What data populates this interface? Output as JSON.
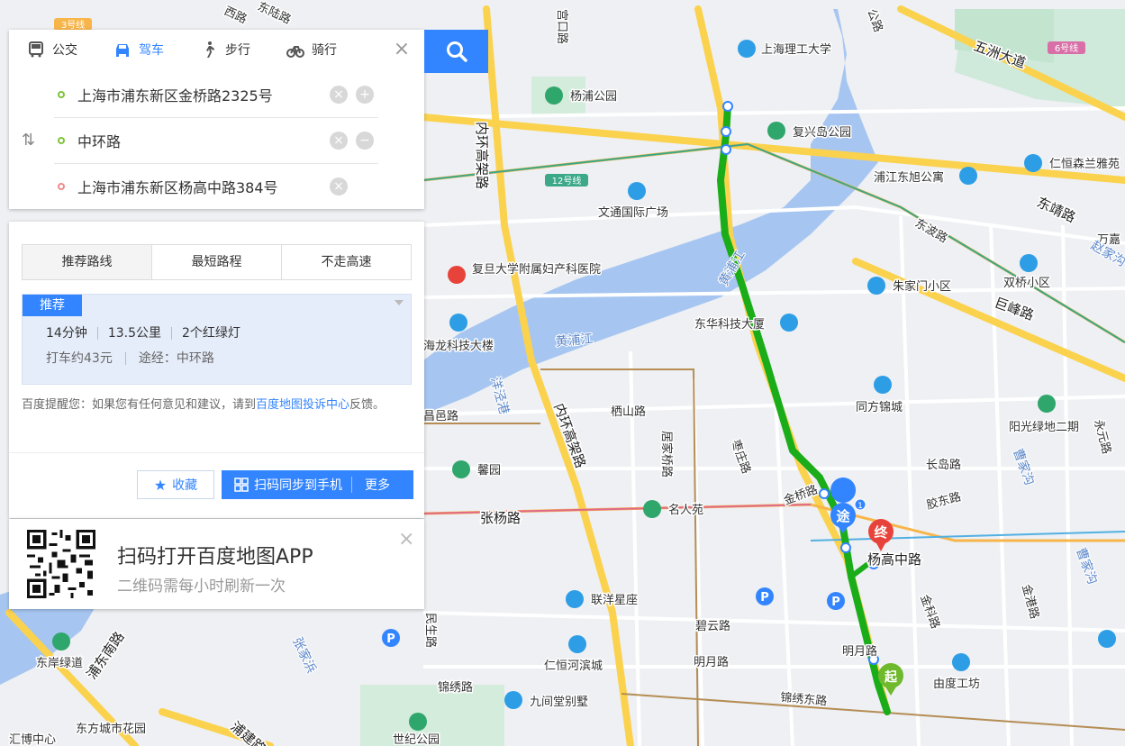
{
  "modes": [
    {
      "label": "公交",
      "icon": "bus-icon"
    },
    {
      "label": "驾车",
      "icon": "car-icon"
    },
    {
      "label": "步行",
      "icon": "walk-icon"
    },
    {
      "label": "骑行",
      "icon": "bike-icon"
    }
  ],
  "active_mode": "驾车",
  "route": {
    "start": "上海市浦东新区金桥路2325号",
    "via": "中环路",
    "end": "上海市浦东新区杨高中路384号"
  },
  "result_tabs": [
    "推荐路线",
    "最短路程",
    "不走高速"
  ],
  "plan": {
    "badge": "推荐",
    "time": "14分钟",
    "distance": "13.5公里",
    "lights": "2个红绿灯",
    "taxi": "打车约43元",
    "via": "途经：中环路"
  },
  "tip": {
    "prefix": "百度提醒您：如果您有任何意见和建议，请到",
    "link": "百度地图投诉中心",
    "suffix": "反馈。"
  },
  "buttons": {
    "favorite": "收藏",
    "sync": "扫码同步到手机",
    "more": "更多"
  },
  "qr": {
    "title": "扫码打开百度地图APP",
    "subtitle": "二维码需每小时刷新一次"
  },
  "colors": {
    "accent": "#3385ff",
    "route": "#1aad19",
    "start_marker": "#6fb92c",
    "end_marker": "#e8433a",
    "via_marker": "#3385ff"
  },
  "map": {
    "markers": {
      "start": "起",
      "end": "终",
      "via": "途",
      "via_badge": "1",
      "parking": "P"
    },
    "roads": [
      "五洲大道",
      "内环高架路",
      "内环高架路",
      "东靖路",
      "巨峰路",
      "张杨路",
      "杨高中路",
      "碧云路",
      "明月路",
      "明月路",
      "锦绣东路",
      "锦绣路",
      "浦东南路",
      "浦建路",
      "东陆路",
      "东波路",
      "栖山路",
      "金桥路",
      "居家桥路",
      "枣庄路",
      "长岛路",
      "胶东路",
      "民生路",
      "金科路",
      "金港路",
      "昌邑路",
      "永元路",
      "西路",
      "公路",
      "宫口路"
    ],
    "metro": [
      "3号线",
      "6号线",
      "12号线"
    ],
    "water": [
      "黄浦江",
      "黄浦江",
      "洋泾港",
      "曹家沟",
      "曹家沟",
      "张家浜",
      "赵家沟"
    ],
    "pois": [
      "上海理工大学",
      "杨浦公园",
      "复兴岛公园",
      "浦江东旭公寓",
      "仁恒森兰雅苑",
      "万嘉",
      "文通国际广场",
      "复旦大学附属妇产科医院",
      "朱家门小区",
      "双桥小区",
      "海龙科技大楼",
      "东华科技大厦",
      "同方锦城",
      "阳光绿地二期",
      "馨园",
      "名人苑",
      "联洋星座",
      "仁恒河滨城",
      "九间堂别墅",
      "由度工坊",
      "东岸绿道",
      "东方城市花园",
      "汇博中心",
      "世纪公园"
    ]
  }
}
